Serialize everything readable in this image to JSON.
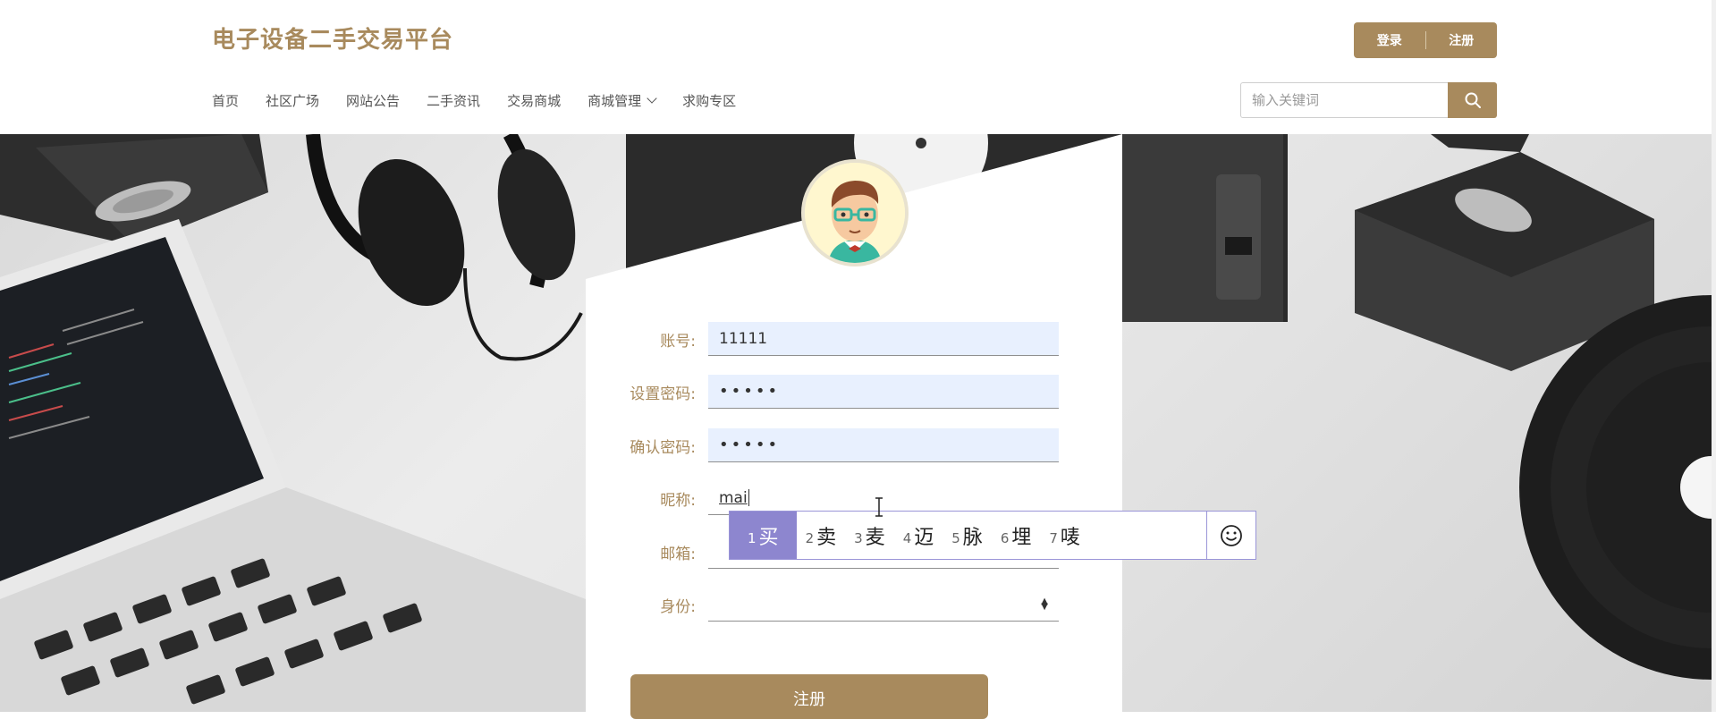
{
  "header": {
    "site_title": "电子设备二手交易平台",
    "login_label": "登录",
    "register_label": "注册",
    "nav": [
      "首页",
      "社区广场",
      "网站公告",
      "二手资讯",
      "交易商城",
      "商城管理",
      "求购专区"
    ],
    "search_placeholder": "输入关键词"
  },
  "form": {
    "account_label": "账号:",
    "account_value": "11111",
    "password_label": "设置密码:",
    "password_value": "•••••",
    "confirm_label": "确认密码:",
    "confirm_value": "•••••",
    "nickname_label": "昵称:",
    "nickname_value": "mai",
    "email_label": "邮箱:",
    "email_value": "",
    "identity_label": "身份:",
    "identity_value": "",
    "submit_label": "注册"
  },
  "ime": {
    "candidates": [
      {
        "num": "1",
        "text": "买"
      },
      {
        "num": "2",
        "text": "卖"
      },
      {
        "num": "3",
        "text": "麦"
      },
      {
        "num": "4",
        "text": "迈"
      },
      {
        "num": "5",
        "text": "脉"
      },
      {
        "num": "6",
        "text": "埋"
      },
      {
        "num": "7",
        "text": "唛"
      }
    ],
    "emoji": "☺"
  },
  "colors": {
    "brand": "#a88a5d",
    "autofill": "#e8f0fe",
    "ime_highlight": "#8d86cf"
  },
  "icons": [
    "search-icon",
    "chevron-down-icon",
    "avatar-icon",
    "emoji-icon",
    "text-cursor-icon"
  ]
}
